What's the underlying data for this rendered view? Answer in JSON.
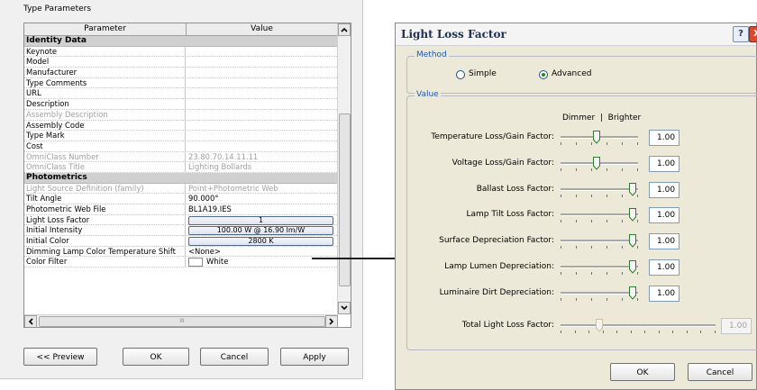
{
  "type_props": {
    "title": "Type Parameters",
    "col_param": "Parameter",
    "col_value": "Value",
    "rows": [
      {
        "name": "Identity Data",
        "value": "",
        "kind": "group"
      },
      {
        "name": "Keynote",
        "value": "",
        "kind": "normal"
      },
      {
        "name": "Model",
        "value": "",
        "kind": "normal"
      },
      {
        "name": "Manufacturer",
        "value": "",
        "kind": "normal"
      },
      {
        "name": "Type Comments",
        "value": "",
        "kind": "normal"
      },
      {
        "name": "URL",
        "value": "",
        "kind": "normal"
      },
      {
        "name": "Description",
        "value": "",
        "kind": "normal"
      },
      {
        "name": "Assembly Description",
        "value": "",
        "kind": "disabled"
      },
      {
        "name": "Assembly Code",
        "value": "",
        "kind": "normal"
      },
      {
        "name": "Type Mark",
        "value": "",
        "kind": "normal"
      },
      {
        "name": "Cost",
        "value": "",
        "kind": "normal"
      },
      {
        "name": "OmniClass Number",
        "value": "23.80.70.14.11.11",
        "kind": "disabled"
      },
      {
        "name": "OmniClass Title",
        "value": "Lighting Bollards",
        "kind": "disabled"
      },
      {
        "name": "Photometrics",
        "value": "",
        "kind": "group"
      },
      {
        "name": "Light Source Definition (family)",
        "value": "Point+Photometric Web",
        "kind": "disabled"
      },
      {
        "name": "Tilt Angle",
        "value": "90.000°",
        "kind": "normal"
      },
      {
        "name": "Photometric Web File",
        "value": "BL1A19.IES",
        "kind": "normal"
      },
      {
        "name": "Light Loss Factor",
        "value": "1",
        "kind": "button"
      },
      {
        "name": "Initial Intensity",
        "value": "100.00 W @ 16.90 lm/W",
        "kind": "button"
      },
      {
        "name": "Initial Color",
        "value": "2800 K",
        "kind": "button"
      },
      {
        "name": "Dimming Lamp Color Temperature Shift",
        "value": "<None>",
        "kind": "normal"
      },
      {
        "name": "Color Filter",
        "value": "White",
        "kind": "swatch"
      }
    ],
    "hscroll_grip": "III",
    "buttons": {
      "preview": "<< Preview",
      "ok": "OK",
      "cancel": "Cancel",
      "apply": "Apply"
    }
  },
  "llf_dialog": {
    "title": "Light Loss Factor",
    "help": "?",
    "close": "X",
    "method_legend": "Method",
    "method_simple": "Simple",
    "method_advanced": "Advanced",
    "method_selected": "Advanced",
    "value_legend": "Value",
    "dimmer_brighter": "Dimmer  |  Brighter",
    "factors": [
      {
        "label": "Temperature Loss/Gain Factor:",
        "value": "1.00",
        "level": 0.5,
        "enabled": true
      },
      {
        "label": "Voltage Loss/Gain Factor:",
        "value": "1.00",
        "level": 0.5,
        "enabled": true
      },
      {
        "label": "Ballast Loss Factor:",
        "value": "1.00",
        "level": 1.0,
        "enabled": true
      },
      {
        "label": "Lamp Tilt Loss Factor:",
        "value": "1.00",
        "level": 1.0,
        "enabled": true
      },
      {
        "label": "Surface Depreciation Factor:",
        "value": "1.00",
        "level": 1.0,
        "enabled": true
      },
      {
        "label": "Lamp Lumen  Depreciation:",
        "value": "1.00",
        "level": 1.0,
        "enabled": true
      },
      {
        "label": "Luminaire Dirt  Depreciation:",
        "value": "1.00",
        "level": 1.0,
        "enabled": true
      }
    ],
    "total": {
      "label": "Total Light Loss Factor:",
      "value": "1.00",
      "level": 0.25,
      "enabled": false
    },
    "ok": "OK",
    "cancel": "Cancel"
  },
  "colors": {
    "accent": "#2456b4",
    "dialog_bg": "#ece9d8",
    "close_red": "#d84a2e",
    "radio_green": "#1a8a1a"
  }
}
